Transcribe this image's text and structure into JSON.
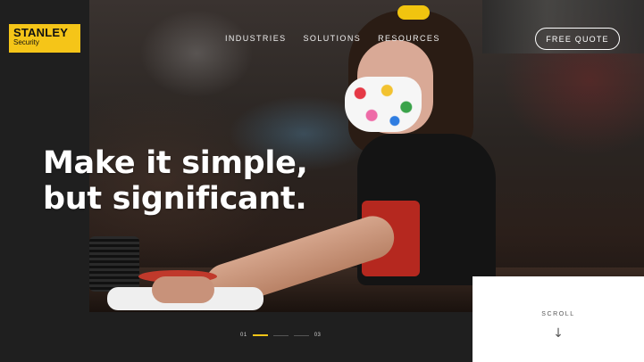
{
  "logo": {
    "brand": "STANLEY",
    "sub": "Security"
  },
  "nav": {
    "items": [
      "INDUSTRIES",
      "SOLUTIONS",
      "RESOURCES"
    ]
  },
  "cta": {
    "label": "FREE QUOTE"
  },
  "hero": {
    "line1": "Make it simple,",
    "line2": "but significant."
  },
  "slider": {
    "current": "01",
    "total": "03",
    "current_index": 1,
    "count": 3
  },
  "scroll": {
    "label": "SCROLL",
    "arrow": "↓"
  },
  "colors": {
    "accent": "#f5c518",
    "background": "#1f1f1f",
    "panel": "#ffffff"
  },
  "icons": {
    "scroll": "arrow-down-icon"
  }
}
